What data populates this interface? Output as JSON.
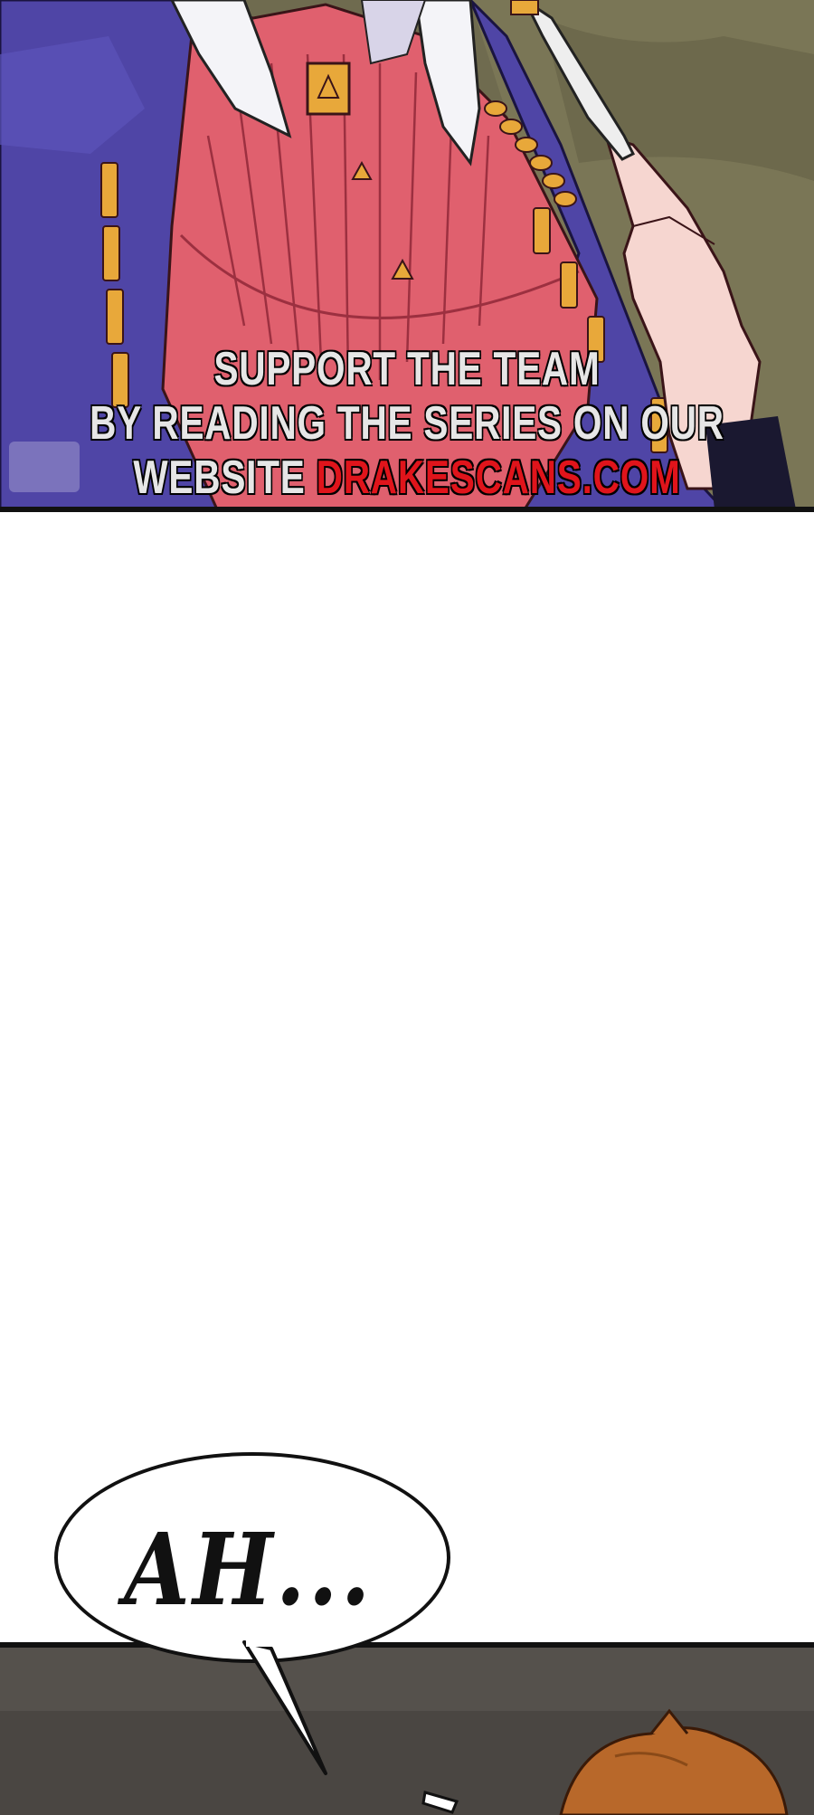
{
  "watermark": {
    "line1": "SUPPORT THE TEAM",
    "line2": "BY READING THE SERIES ON OUR",
    "line3_prefix": "WEBSITE ",
    "line3_site": "DRAKESCANS.COM"
  },
  "speech_bubble": {
    "text": "AH..."
  },
  "colors": {
    "uniform": "#5147a8",
    "shirt": "#e0606e",
    "trim": "#e8a83a",
    "hair": "#f4f4f8",
    "skin": "#f6d6d0",
    "background_wall": "#6e6a4e",
    "watermark_red": "#e0141b",
    "bottom_panel": "#4a4642"
  }
}
